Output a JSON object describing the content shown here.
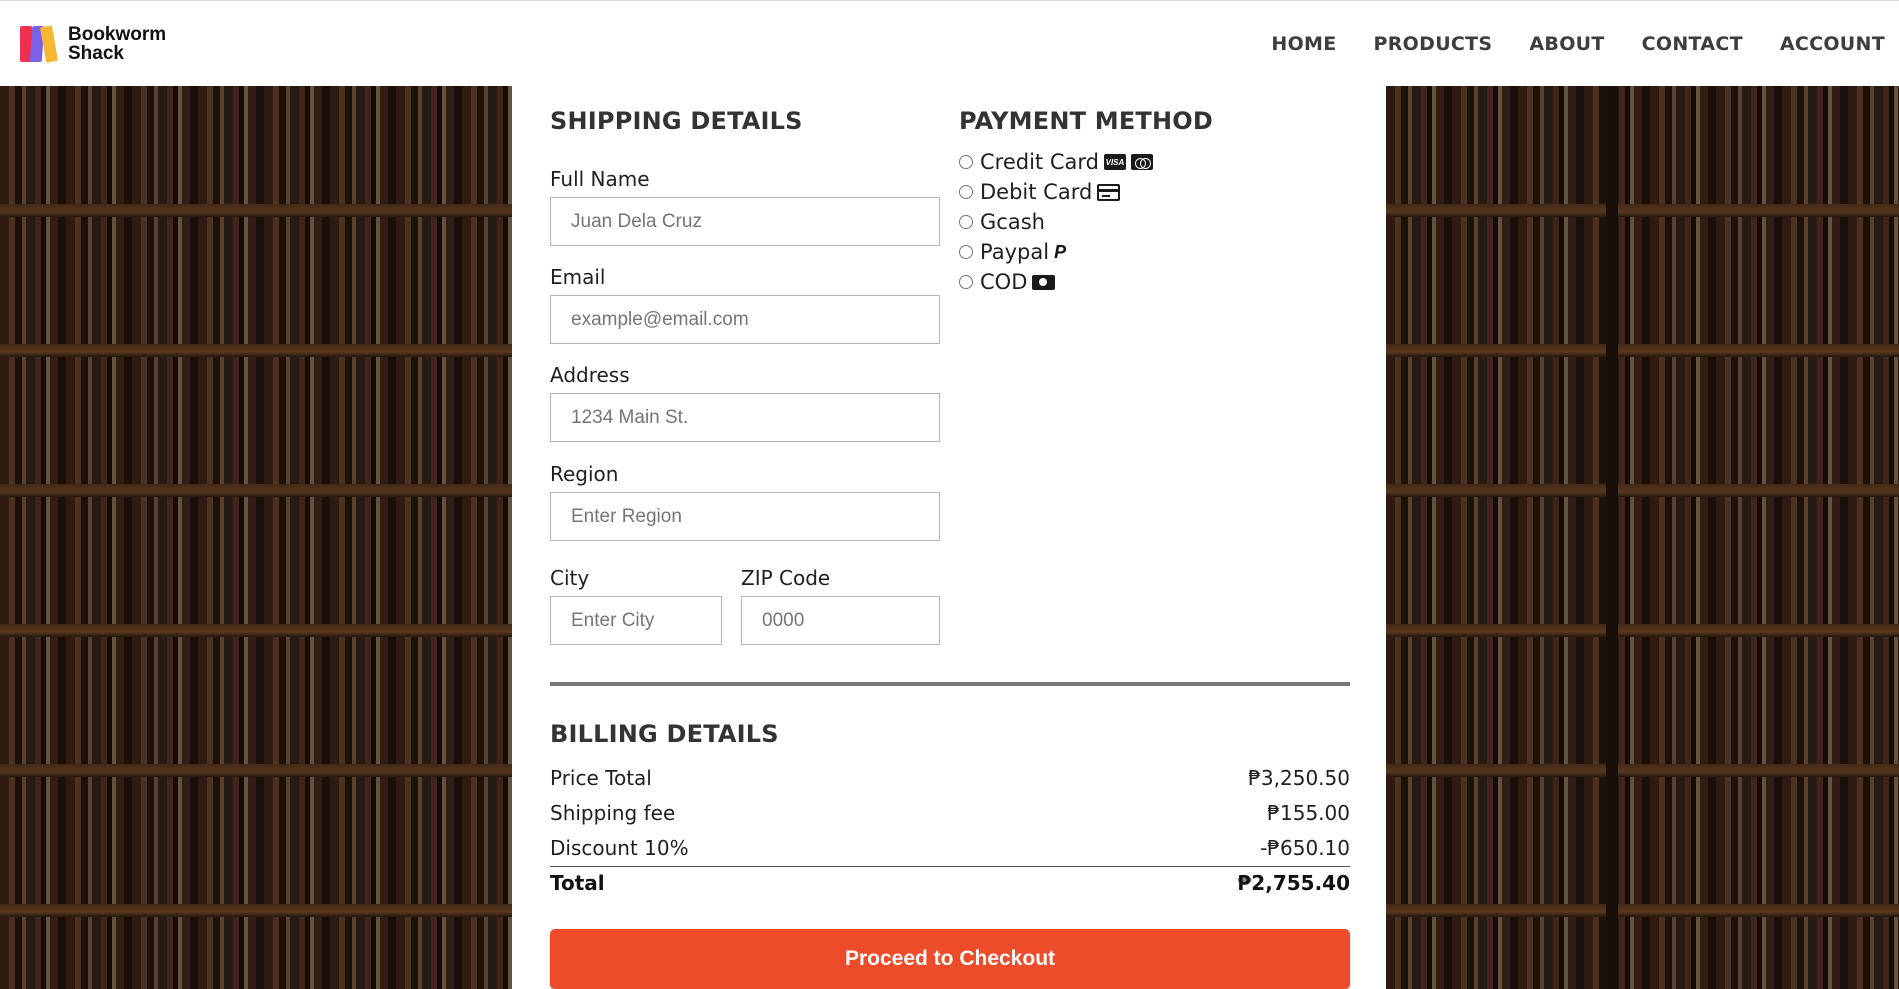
{
  "brand": {
    "line1": "Bookworm",
    "line2": "Shack"
  },
  "nav": {
    "home": "HOME",
    "products": "PRODUCTS",
    "about": "ABOUT",
    "contact": "CONTACT",
    "account": "ACCOUNT"
  },
  "shipping": {
    "title": "SHIPPING DETAILS",
    "full_name": {
      "label": "Full Name",
      "placeholder": "Juan Dela Cruz"
    },
    "email": {
      "label": "Email",
      "placeholder": "example@email.com"
    },
    "address": {
      "label": "Address",
      "placeholder": "1234 Main St."
    },
    "region": {
      "label": "Region",
      "placeholder": "Enter Region"
    },
    "city": {
      "label": "City",
      "placeholder": "Enter City"
    },
    "zip": {
      "label": "ZIP Code",
      "placeholder": "0000"
    }
  },
  "payment": {
    "title": "PAYMENT METHOD",
    "options": [
      {
        "label": "Credit Card",
        "icons": [
          "visa-icon",
          "mastercard-icon"
        ]
      },
      {
        "label": "Debit Card",
        "icons": [
          "credit-card-icon"
        ]
      },
      {
        "label": "Gcash",
        "icons": []
      },
      {
        "label": "Paypal",
        "icons": [
          "paypal-icon"
        ]
      },
      {
        "label": "COD",
        "icons": [
          "cash-icon"
        ]
      }
    ]
  },
  "billing": {
    "title": "BILLING DETAILS",
    "rows": [
      {
        "label": "Price Total",
        "value": "₱3,250.50"
      },
      {
        "label": "Shipping fee",
        "value": "₱155.00"
      },
      {
        "label": "Discount 10%",
        "value": "-₱650.10"
      }
    ],
    "total": {
      "label": "Total",
      "value": "₱2,755.40"
    }
  },
  "checkout_button": "Proceed to Checkout",
  "colors": {
    "accent": "#ec4c2a",
    "logo_red": "#ef2f4f",
    "logo_purple": "#7b61e8",
    "logo_yellow": "#f7b733"
  }
}
